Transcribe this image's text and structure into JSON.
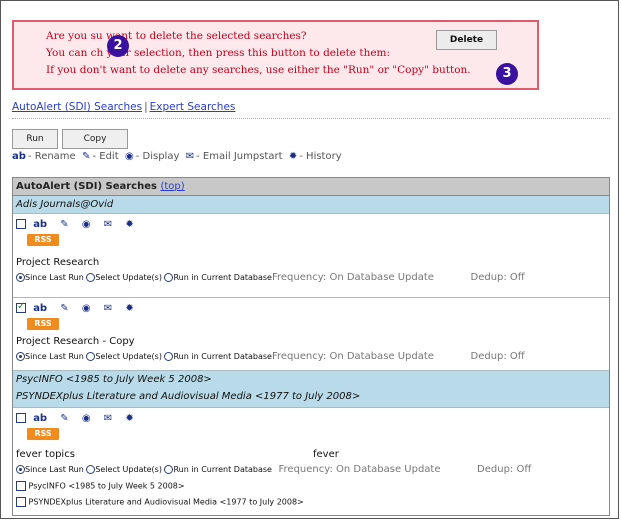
{
  "confirm": {
    "line1": "Are you su       want to delete the selected searches?",
    "line2": "You can ch        your selection, then press this button to delete them:",
    "line3": "If you don't want to delete any searches, use either the \"Run\" or \"Copy\" button.",
    "delete_label": "Delete",
    "badge2": "2",
    "badge3": "3"
  },
  "tabs": {
    "autoalert": "AutoAlert (SDI) Searches",
    "sep": "|",
    "expert": "Expert Searches"
  },
  "toolbar": {
    "run": "Run",
    "copy": "Copy"
  },
  "legend": {
    "rename": "- Rename",
    "edit": "- Edit",
    "display": "- Display",
    "email": "- Email Jumpstart",
    "history": "- History"
  },
  "table": {
    "header": "AutoAlert (SDI) Searches",
    "top_link": "(top)",
    "group1": "Adis Journals@Ovid",
    "rss": "RSS",
    "row1": {
      "name": "Project Research",
      "since": "Since Last Run",
      "select": "Select Update(s)",
      "current": "Run in Current Database",
      "freq": "Frequency: On Database Update",
      "dedup": "Dedup: Off"
    },
    "row2": {
      "name": "Project Research - Copy",
      "since": "Since Last Run",
      "select": "Select Update(s)",
      "current": "Run in Current Database",
      "freq": "Frequency: On Database Update",
      "dedup": "Dedup: Off"
    },
    "group2_line1": "PsycINFO <1985 to July Week 5 2008>",
    "group2_line2": "PSYNDEXplus Literature and Audiovisual Media <1977 to July 2008>",
    "row3": {
      "name": "fever topics",
      "term": "fever",
      "since": "Since Last Run",
      "select": "Select Update(s)",
      "current": "Run in Current Database",
      "freq": "Frequency: On Database Update",
      "dedup": "Dedup: Off",
      "db1": "PsycINFO <1985 to July Week 5 2008>",
      "db2": "PSYNDEXplus Literature and Audiovisual Media <1977 to July 2008>"
    }
  }
}
